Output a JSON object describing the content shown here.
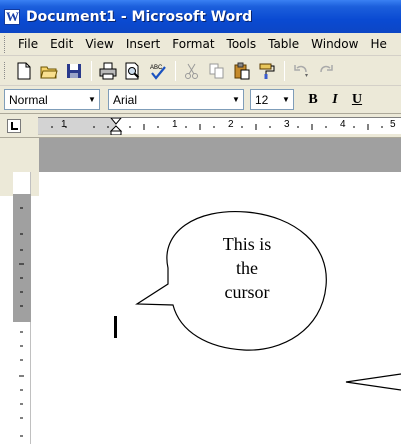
{
  "window": {
    "title": "Document1 - Microsoft Word"
  },
  "menu": {
    "items": [
      {
        "label": "File"
      },
      {
        "label": "Edit"
      },
      {
        "label": "View"
      },
      {
        "label": "Insert"
      },
      {
        "label": "Format"
      },
      {
        "label": "Tools"
      },
      {
        "label": "Table"
      },
      {
        "label": "Window"
      },
      {
        "label": "He"
      }
    ]
  },
  "toolbar": {
    "icons": [
      "new-document-icon",
      "open-folder-icon",
      "save-icon",
      "print-icon",
      "print-preview-icon",
      "spelling-icon",
      "cut-icon",
      "copy-icon",
      "paste-icon",
      "format-painter-icon",
      "undo-icon",
      "redo-icon"
    ]
  },
  "formatting": {
    "style": "Normal",
    "font": "Arial",
    "size": "12",
    "bold_label": "B",
    "italic_label": "I",
    "underline_label": "U"
  },
  "ruler": {
    "numbers": [
      "1",
      "1",
      "2",
      "3",
      "4",
      "5"
    ]
  },
  "callout": {
    "text_lines": [
      "This is",
      "the",
      "cursor"
    ]
  },
  "colors": {
    "title_bar": "#0a4ad2",
    "chrome": "#ece9d8",
    "workspace": "#a0a0a0"
  }
}
